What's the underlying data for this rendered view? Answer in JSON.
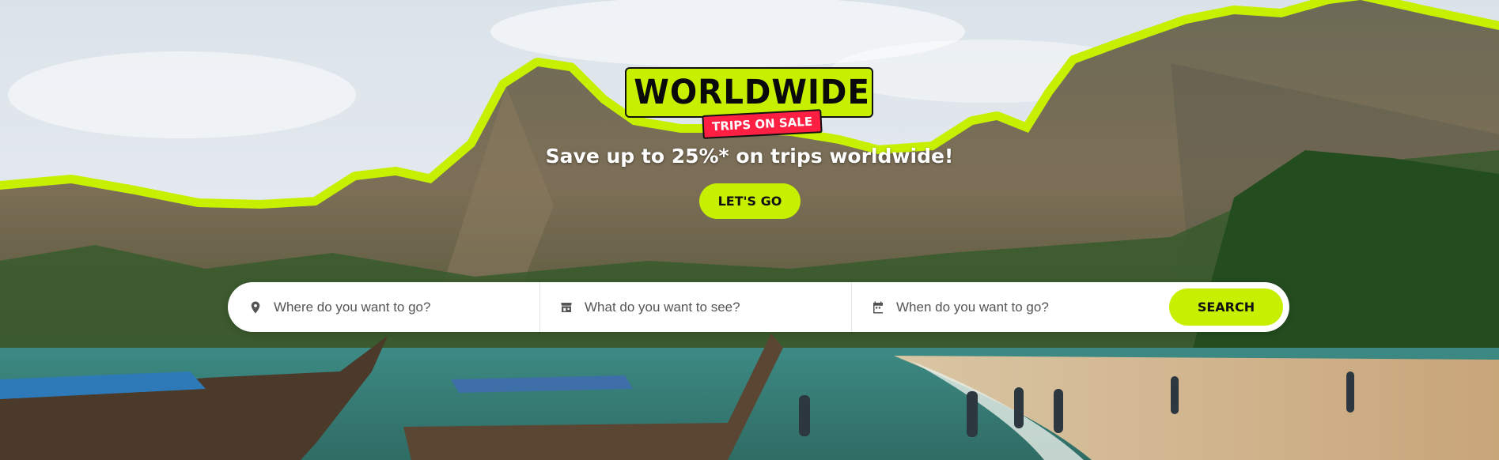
{
  "hero": {
    "badge_title": "WORLDWIDE",
    "badge_subtitle": "TRIPS ON SALE",
    "headline": "Save up to 25%* on trips worldwide!",
    "cta_label": "LET'S GO"
  },
  "search": {
    "where_placeholder": "Where do you want to go?",
    "what_placeholder": "What do you want to see?",
    "when_placeholder": "When do you want to go?",
    "button_label": "SEARCH",
    "where_icon": "map-pin-icon",
    "what_icon": "storefront-icon",
    "when_icon": "calendar-icon"
  },
  "colors": {
    "accent": "#c6f000",
    "sale_red": "#ff1f43",
    "text_dark": "#111111"
  }
}
